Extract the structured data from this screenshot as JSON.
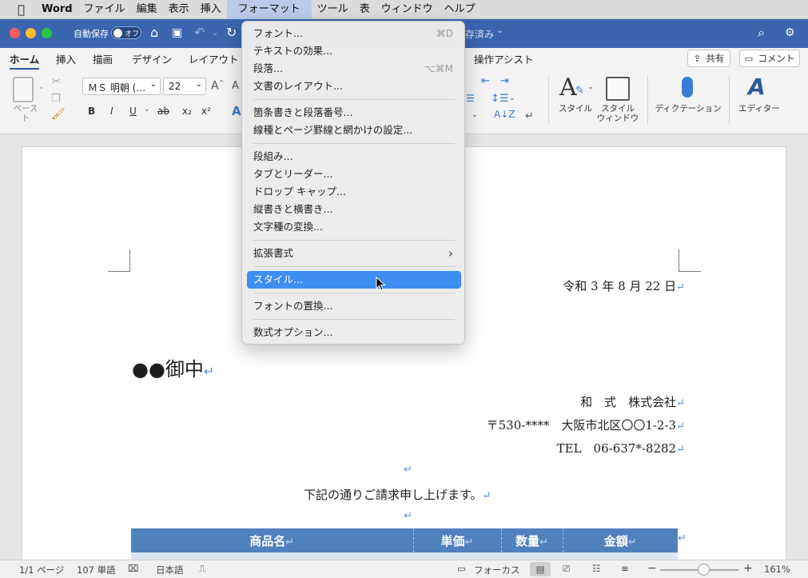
{
  "menubar": {
    "items": [
      "Word",
      "ファイル",
      "編集",
      "表示",
      "挿入",
      "フォーマット",
      "ツール",
      "表",
      "ウィンドウ",
      "ヘルプ"
    ]
  },
  "titlebar": {
    "autosave_label": "自動保存",
    "autosave_state": "オフ",
    "save_status": "存済み"
  },
  "ribbon": {
    "tabs": [
      "ホーム",
      "挿入",
      "描画",
      "デザイン",
      "レイアウト",
      "操作アシスト"
    ],
    "share_label": "共有",
    "comment_label": "コメント",
    "paste_label": "ペースト",
    "font_name": "ＭＳ 明朝 (…",
    "font_size": "22",
    "bold": "B",
    "italic": "I",
    "underline": "U",
    "strike": "ab",
    "subscript": "x₂",
    "superscript": "x²",
    "styles_label": "スタイル",
    "styles_window_label": "スタイル\nウィンドウ",
    "dictation_label": "ディクテーション",
    "editor_label": "エディター"
  },
  "format_menu": {
    "items": [
      {
        "label": "フォント...",
        "shortcut": "⌘D"
      },
      {
        "label": "テキストの効果...",
        "shortcut": ""
      },
      {
        "label": "段落...",
        "shortcut": "⌥⌘M"
      },
      {
        "label": "文書のレイアウト...",
        "shortcut": ""
      },
      {
        "label": "箇条書きと段落番号...",
        "shortcut": ""
      },
      {
        "label": "線種とページ罫線と網かけの設定...",
        "shortcut": ""
      },
      {
        "label": "段組み...",
        "shortcut": ""
      },
      {
        "label": "タブとリーダー...",
        "shortcut": ""
      },
      {
        "label": "ドロップ キャップ...",
        "shortcut": ""
      },
      {
        "label": "縦書きと横書き...",
        "shortcut": ""
      },
      {
        "label": "文字種の変換...",
        "shortcut": ""
      },
      {
        "label": "拡張書式",
        "shortcut": "›"
      },
      {
        "label": "スタイル...",
        "shortcut": ""
      },
      {
        "label": "フォントの置換...",
        "shortcut": ""
      },
      {
        "label": "数式オプション...",
        "shortcut": ""
      }
    ]
  },
  "document": {
    "date": "令和 3 年 8 月 22 日",
    "addressee": "●●御中",
    "company": "和　式　株式会社",
    "address": "〒530-****　大阪市北区〇〇1-2-3",
    "tel": "TEL　06-637*-8282",
    "intro": "下記の通りご請求申し上げます。",
    "table_headers": [
      "商品名",
      "単価",
      "数量",
      "金額"
    ],
    "para_mark": "↵"
  },
  "statusbar": {
    "page": "1/1 ページ",
    "words": "107 単語",
    "language": "日本語",
    "focus": "フォーカス",
    "zoom": "161%"
  },
  "colors": {
    "title_bar": "#3a66b0",
    "menu_highlight": "#3d8ef0",
    "table_header": "#4f81bd"
  }
}
